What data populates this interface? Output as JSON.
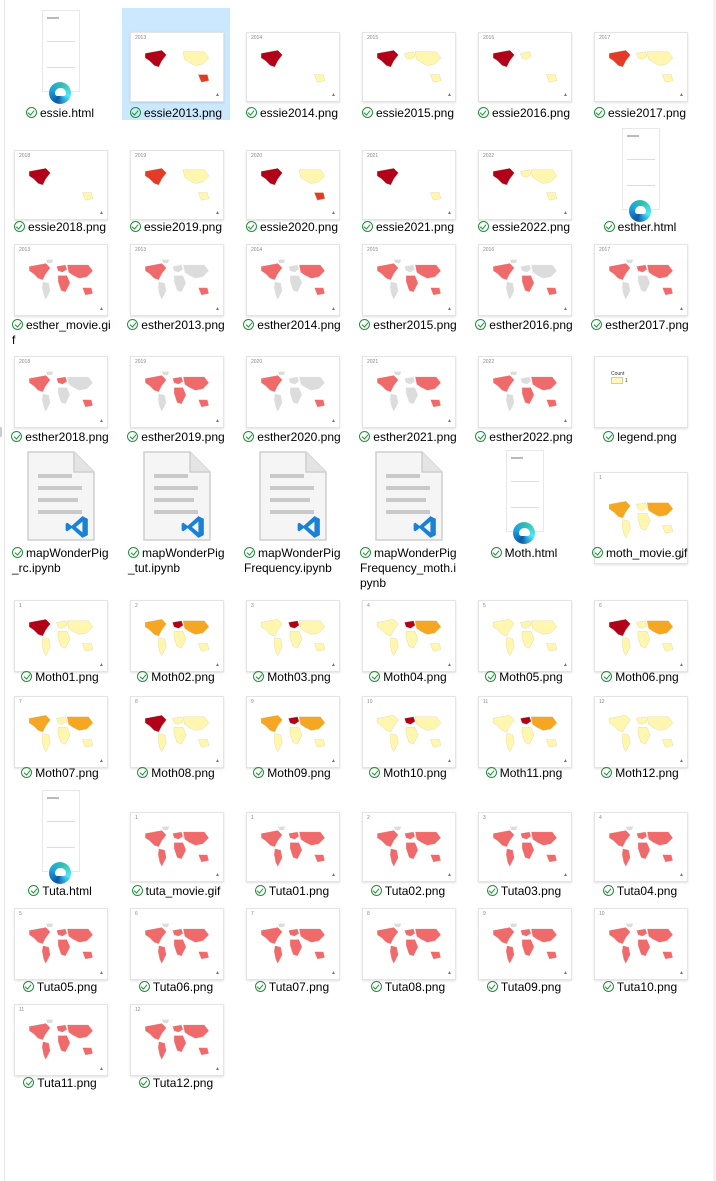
{
  "window": {
    "view": "Large icons"
  },
  "colors": {
    "selection": "#cce8ff",
    "sync_check": "#1e8f3a",
    "essie_dark": "#b2001a",
    "essie_mid": "#e53a28",
    "essie_light": "#fff6b0",
    "esther_red": "#ef6a6a",
    "moth_orange": "#f5a623",
    "land_gray": "#dcdcdc"
  },
  "files": [
    {
      "name": "essie.html",
      "kind": "html",
      "selected": false
    },
    {
      "name": "essie2013.png",
      "kind": "map",
      "style": "essie",
      "year": "2013",
      "selected": true
    },
    {
      "name": "essie2014.png",
      "kind": "map",
      "style": "essie",
      "year": "2014"
    },
    {
      "name": "essie2015.png",
      "kind": "map",
      "style": "essie",
      "year": "2015"
    },
    {
      "name": "essie2016.png",
      "kind": "map",
      "style": "essie",
      "year": "2016"
    },
    {
      "name": "essie2017.png",
      "kind": "map",
      "style": "essie",
      "year": "2017"
    },
    {
      "name": "essie2018.png",
      "kind": "map",
      "style": "essie",
      "year": "2018"
    },
    {
      "name": "essie2019.png",
      "kind": "map",
      "style": "essie",
      "year": "2019"
    },
    {
      "name": "essie2020.png",
      "kind": "map",
      "style": "essie",
      "year": "2020"
    },
    {
      "name": "essie2021.png",
      "kind": "map",
      "style": "essie",
      "year": "2021"
    },
    {
      "name": "essie2022.png",
      "kind": "map",
      "style": "essie",
      "year": "2022"
    },
    {
      "name": "esther.html",
      "kind": "html"
    },
    {
      "name": "esther_movie.gif",
      "kind": "map",
      "style": "esther",
      "year": "2013",
      "wrap": true
    },
    {
      "name": "esther2013.png",
      "kind": "map",
      "style": "esther",
      "year": "2013"
    },
    {
      "name": "esther2014.png",
      "kind": "map",
      "style": "esther",
      "year": "2014"
    },
    {
      "name": "esther2015.png",
      "kind": "map",
      "style": "esther",
      "year": "2015"
    },
    {
      "name": "esther2016.png",
      "kind": "map",
      "style": "esther",
      "year": "2016"
    },
    {
      "name": "esther2017.png",
      "kind": "map",
      "style": "esther",
      "year": "2017"
    },
    {
      "name": "esther2018.png",
      "kind": "map",
      "style": "esther",
      "year": "2018"
    },
    {
      "name": "esther2019.png",
      "kind": "map",
      "style": "esther",
      "year": "2019"
    },
    {
      "name": "esther2020.png",
      "kind": "map",
      "style": "esther",
      "year": "2020"
    },
    {
      "name": "esther2021.png",
      "kind": "map",
      "style": "esther",
      "year": "2021"
    },
    {
      "name": "esther2022.png",
      "kind": "map",
      "style": "esther",
      "year": "2022"
    },
    {
      "name": "legend.png",
      "kind": "legend",
      "legend_title": "Count",
      "legend_value": "1"
    },
    {
      "name": "mapWonderPig_rc.ipynb",
      "kind": "ipynb",
      "wrap": true
    },
    {
      "name": "mapWonderPig_tut.ipynb",
      "kind": "ipynb",
      "wrap": true
    },
    {
      "name": "mapWonderPigFrequency.ipynb",
      "kind": "ipynb",
      "wrap": true
    },
    {
      "name": "mapWonderPigFrequency_moth.ipynb",
      "kind": "ipynb",
      "wrap": true
    },
    {
      "name": "Moth.html",
      "kind": "html"
    },
    {
      "name": "moth_movie.gif",
      "kind": "map",
      "style": "moth",
      "year": "1",
      "wrap": true
    },
    {
      "name": "Moth01.png",
      "kind": "map",
      "style": "moth",
      "year": "1"
    },
    {
      "name": "Moth02.png",
      "kind": "map",
      "style": "moth",
      "year": "2"
    },
    {
      "name": "Moth03.png",
      "kind": "map",
      "style": "moth",
      "year": "3"
    },
    {
      "name": "Moth04.png",
      "kind": "map",
      "style": "moth",
      "year": "4"
    },
    {
      "name": "Moth05.png",
      "kind": "map",
      "style": "moth",
      "year": "5"
    },
    {
      "name": "Moth06.png",
      "kind": "map",
      "style": "moth",
      "year": "6"
    },
    {
      "name": "Moth07.png",
      "kind": "map",
      "style": "moth",
      "year": "7"
    },
    {
      "name": "Moth08.png",
      "kind": "map",
      "style": "moth",
      "year": "8"
    },
    {
      "name": "Moth09.png",
      "kind": "map",
      "style": "moth",
      "year": "9"
    },
    {
      "name": "Moth10.png",
      "kind": "map",
      "style": "moth",
      "year": "10"
    },
    {
      "name": "Moth11.png",
      "kind": "map",
      "style": "moth",
      "year": "11"
    },
    {
      "name": "Moth12.png",
      "kind": "map",
      "style": "moth",
      "year": "12"
    },
    {
      "name": "Tuta.html",
      "kind": "html"
    },
    {
      "name": "tuta_movie.gif",
      "kind": "map",
      "style": "tuta",
      "year": "1"
    },
    {
      "name": "Tuta01.png",
      "kind": "map",
      "style": "tuta",
      "year": "1"
    },
    {
      "name": "Tuta02.png",
      "kind": "map",
      "style": "tuta",
      "year": "2"
    },
    {
      "name": "Tuta03.png",
      "kind": "map",
      "style": "tuta",
      "year": "3"
    },
    {
      "name": "Tuta04.png",
      "kind": "map",
      "style": "tuta",
      "year": "4"
    },
    {
      "name": "Tuta05.png",
      "kind": "map",
      "style": "tuta",
      "year": "5"
    },
    {
      "name": "Tuta06.png",
      "kind": "map",
      "style": "tuta",
      "year": "6"
    },
    {
      "name": "Tuta07.png",
      "kind": "map",
      "style": "tuta",
      "year": "7"
    },
    {
      "name": "Tuta08.png",
      "kind": "map",
      "style": "tuta",
      "year": "8"
    },
    {
      "name": "Tuta09.png",
      "kind": "map",
      "style": "tuta",
      "year": "9"
    },
    {
      "name": "Tuta10.png",
      "kind": "map",
      "style": "tuta",
      "year": "10"
    },
    {
      "name": "Tuta11.png",
      "kind": "map",
      "style": "tuta",
      "year": "11"
    },
    {
      "name": "Tuta12.png",
      "kind": "map",
      "style": "tuta",
      "year": "12"
    }
  ]
}
